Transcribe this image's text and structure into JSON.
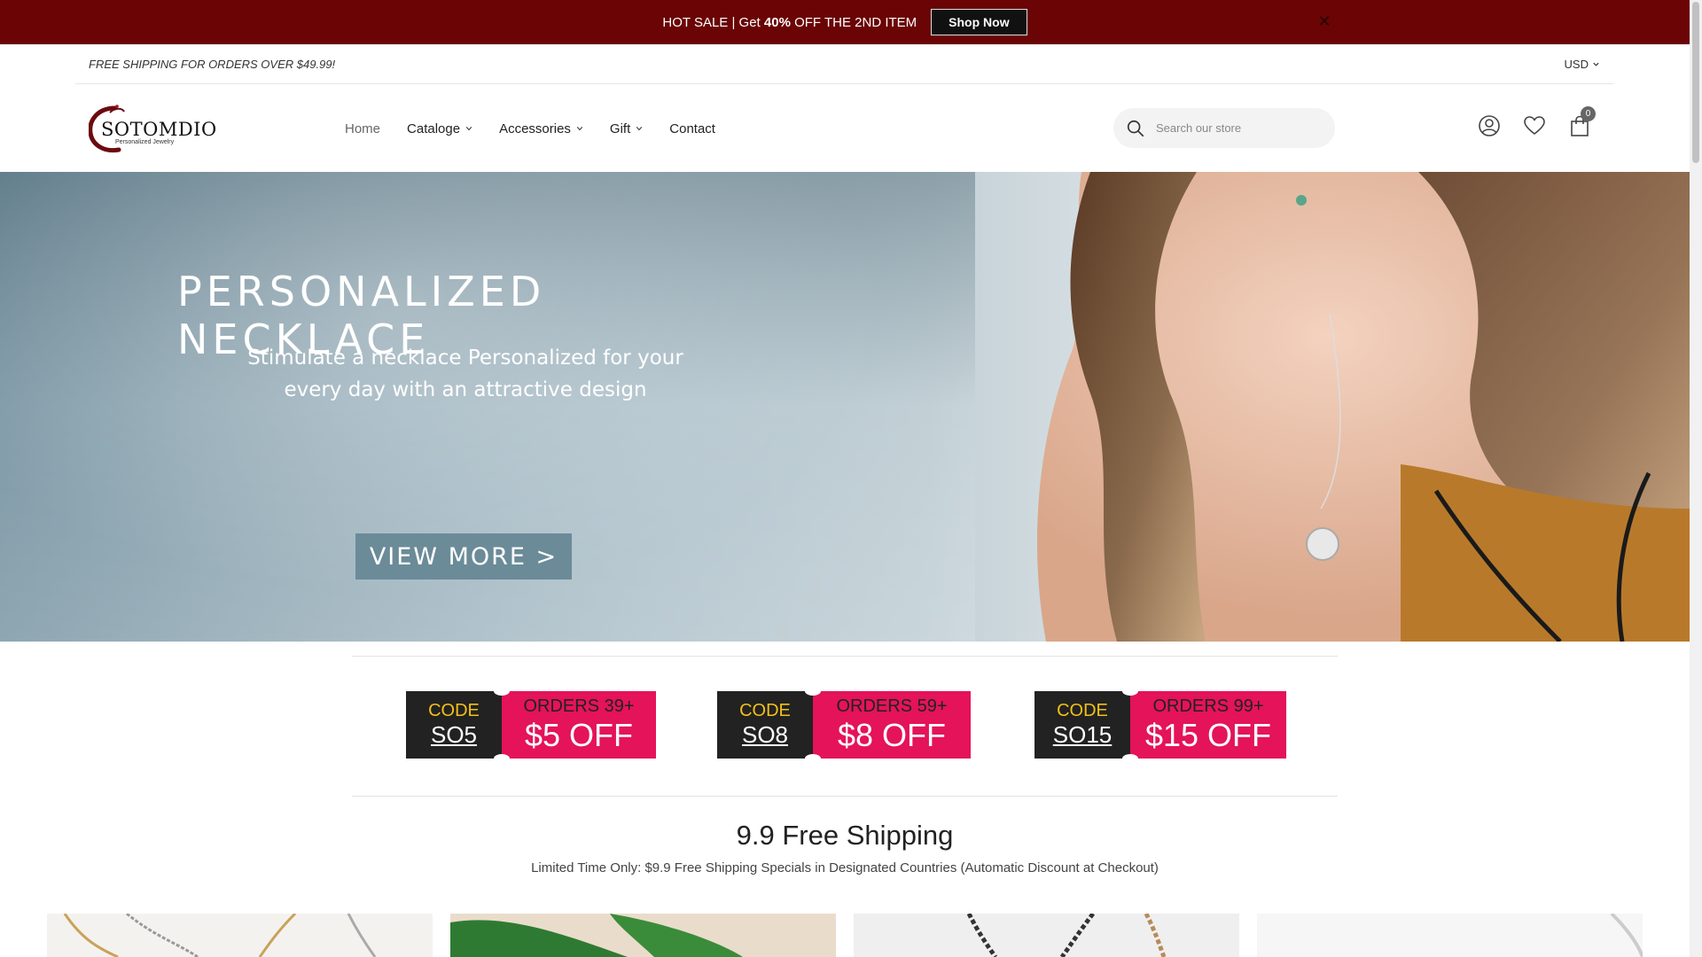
{
  "announcement": {
    "text_prefix": "HOT SALE | Get ",
    "text_bold": "40%",
    "text_suffix": " OFF THE 2ND ITEM",
    "button": "Shop Now",
    "close": "✕",
    "bg_color": "#6a0405"
  },
  "utility": {
    "shipping": "FREE SHIPPING FOR ORDERS OVER $49.99!",
    "currency": "USD"
  },
  "header": {
    "logo_text": "SOTOMDIO",
    "logo_tagline": "Personalized Jewelry",
    "nav": [
      {
        "label": "Home"
      },
      {
        "label": "Cataloge"
      },
      {
        "label": "Accessories"
      },
      {
        "label": "Gift"
      },
      {
        "label": "Contact"
      }
    ],
    "search_placeholder": "Search our store",
    "cart_count": "0",
    "icons": [
      "search-icon",
      "account-icon",
      "wishlist-heart-icon",
      "cart-bag-icon"
    ]
  },
  "hero": {
    "title": "PERSONALIZED NECKLACE",
    "subtitle_line1": "Stimulate a necklace Personalized for your",
    "subtitle_line2": "every day with an attractive design",
    "button": "VIEW MORE >"
  },
  "coupons": [
    {
      "label": "CODE",
      "code": "SO5",
      "orders": "ORDERS 39+",
      "amount": "$5 OFF"
    },
    {
      "label": "CODE",
      "code": "SO8",
      "orders": "ORDERS 59+",
      "amount": "$8 OFF"
    },
    {
      "label": "CODE",
      "code": "SO15",
      "orders": "ORDERS 99+",
      "amount": "$15 OFF"
    }
  ],
  "section": {
    "title": "9.9 Free Shipping",
    "subtitle": "Limited Time Only: $9.9 Free Shipping Specials in Designated Countries (Automatic Discount at Checkout)"
  },
  "colors": {
    "coupon_dark": "#222222",
    "coupon_pink": "#e4135a",
    "coupon_yellow": "#f3c018"
  }
}
